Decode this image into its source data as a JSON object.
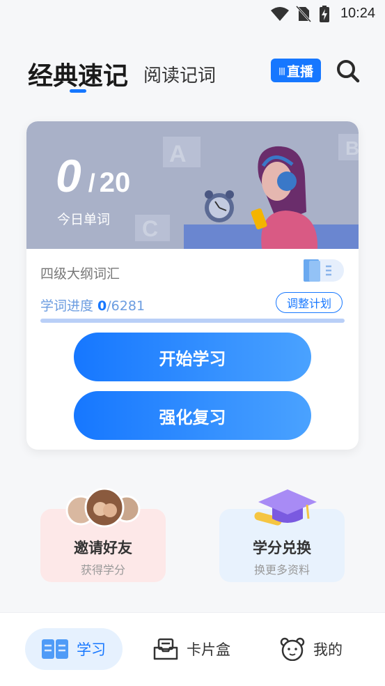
{
  "status_bar": {
    "time": "10:24"
  },
  "header": {
    "tab_active": "经典速记",
    "tab_inactive": "阅读记词",
    "live_label": "直播"
  },
  "study_card": {
    "today_done": "0",
    "separator": "/",
    "today_goal": "20",
    "today_label": "今日单词",
    "book_name": "四级大纲词汇",
    "progress_prefix": "学词进度 ",
    "progress_done": "0",
    "progress_total": "/6281",
    "progress_fraction": 0,
    "plan_button": "调整计划",
    "start_button": "开始学习",
    "review_button": "强化复习"
  },
  "features": {
    "invite": {
      "title": "邀请好友",
      "subtitle": "获得学分"
    },
    "redeem": {
      "title": "学分兑换",
      "subtitle": "换更多资料"
    }
  },
  "bottom_nav": [
    {
      "label": "学习",
      "icon": "book-icon",
      "active": true
    },
    {
      "label": "卡片盒",
      "icon": "card-box-icon",
      "active": false
    },
    {
      "label": "我的",
      "icon": "bear-icon",
      "active": false
    }
  ],
  "colors": {
    "accent": "#1677ff",
    "banner": "#a9b1c8"
  }
}
